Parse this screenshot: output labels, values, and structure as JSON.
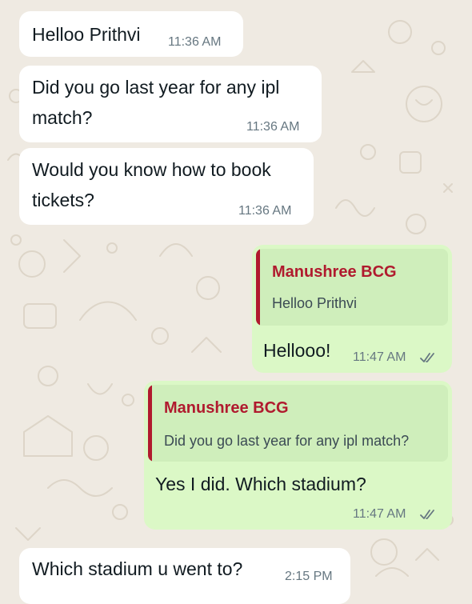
{
  "chat": {
    "messages": [
      {
        "direction": "incoming",
        "text": "Helloo Prithvi",
        "time": "11:36 AM"
      },
      {
        "direction": "incoming",
        "text_lines": [
          "Did you go last year for any ipl",
          "match?"
        ],
        "time": "11:36 AM"
      },
      {
        "direction": "incoming",
        "text_lines": [
          "Would you know how to book",
          "tickets?"
        ],
        "time": "11:36 AM"
      },
      {
        "direction": "outgoing",
        "quote": {
          "author": "Manushree BCG",
          "text": "Helloo Prithvi"
        },
        "text": "Hellooo!",
        "time": "11:47 AM",
        "status": "read-double-tick"
      },
      {
        "direction": "outgoing",
        "quote": {
          "author": "Manushree BCG",
          "text": "Did you go last year for any ipl match?"
        },
        "text": "Yes I did. Which stadium?",
        "time": "11:47 AM",
        "status": "read-double-tick"
      },
      {
        "direction": "incoming",
        "text": "Which stadium u went to?",
        "time": "2:15 PM"
      }
    ]
  },
  "colors": {
    "wallpaper": "#efeae2",
    "incoming_bubble": "#ffffff",
    "outgoing_bubble": "#dbf8c6",
    "quote_background": "#cfeebb",
    "quote_accent": "#b01a2e",
    "timestamp": "#667781",
    "tick": "#667781"
  }
}
